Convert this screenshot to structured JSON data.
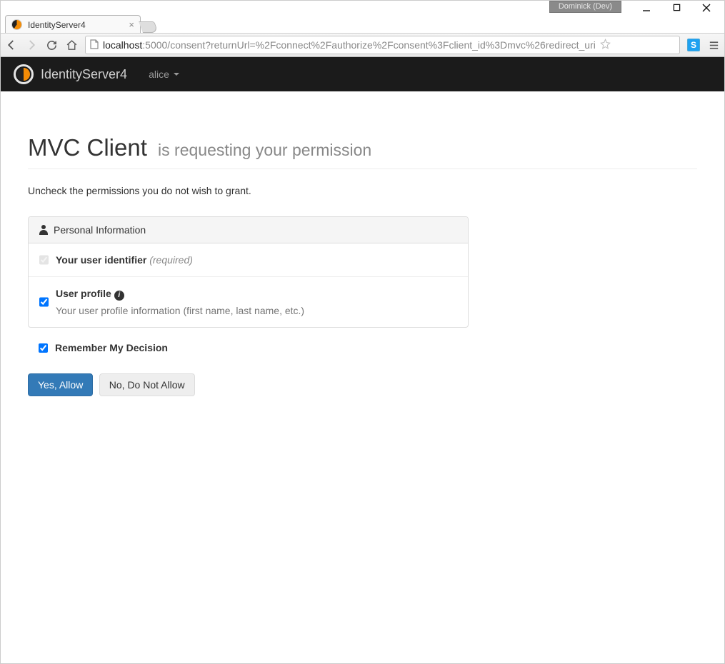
{
  "window": {
    "badge": "Dominick (Dev)"
  },
  "tab": {
    "title": "IdentityServer4"
  },
  "url": {
    "host": "localhost",
    "path": ":5000/consent?returnUrl=%2Fconnect%2Fauthorize%2Fconsent%3Fclient_id%3Dmvc%26redirect_uri"
  },
  "navbar": {
    "brand": "IdentityServer4",
    "user": "alice"
  },
  "page": {
    "client_name": "MVC Client",
    "title_suffix": "is requesting your permission",
    "instructions": "Uncheck the permissions you do not wish to grant.",
    "panel_heading": "Personal Information"
  },
  "scopes": [
    {
      "label": "Your user identifier",
      "required_text": "(required)",
      "checked": true,
      "disabled": true,
      "description": ""
    },
    {
      "label": "User profile",
      "required_text": "",
      "checked": true,
      "disabled": false,
      "description": "Your user profile information (first name, last name, etc.)"
    }
  ],
  "remember": {
    "label": "Remember My Decision",
    "checked": true
  },
  "buttons": {
    "allow": "Yes, Allow",
    "deny": "No, Do Not Allow"
  },
  "ext": {
    "s": "S"
  }
}
